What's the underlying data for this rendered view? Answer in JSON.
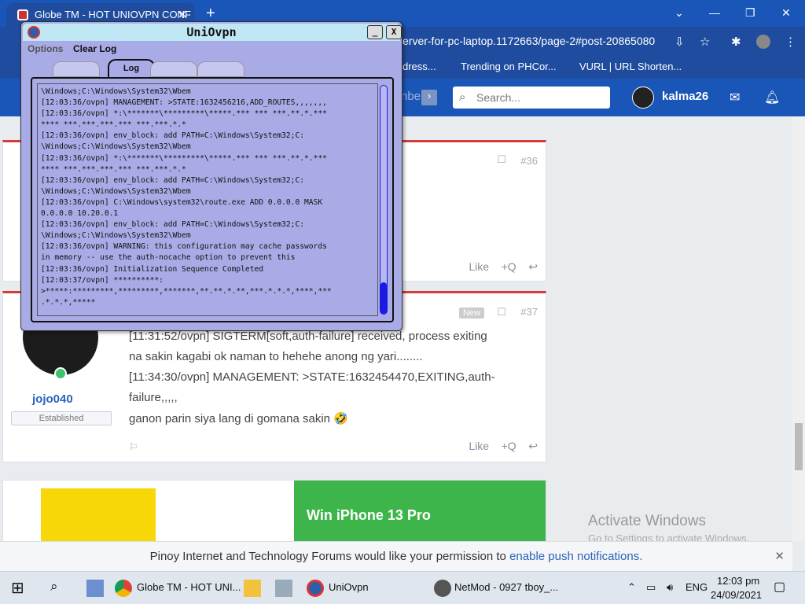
{
  "browser": {
    "tab_title": "Globe TM - HOT UNIOVPN CONF",
    "tab_close": "✕",
    "new_tab": "+",
    "url": "erver-for-pc-laptop.1172663/page-2#post-20865080",
    "bookmarks": [
      "dress...",
      "Trending on PHCor...",
      "VURL | URL Shorten..."
    ],
    "window_controls": [
      "⌄",
      "—",
      "❐",
      "✕"
    ]
  },
  "site": {
    "search_placeholder": "Search...",
    "username": "kalma26",
    "sidebar_label": "nbe"
  },
  "posts": [
    {
      "number": "#36",
      "reactions": [
        "Like",
        "+Q",
        "↩"
      ]
    },
    {
      "number": "#37",
      "badge": "New",
      "author": "jojo040",
      "rank": "Established",
      "lines": [
        "[11:31:52/ovpn] SIGTERM[soft,auth-failure] received, process exiting",
        "na sakin kagabi ok naman to hehehe anong ng yari........",
        "[11:34:30/ovpn] MANAGEMENT: >STATE:1632454470,EXITING,auth-",
        "failure,,,,,",
        "ganon parin siya lang di gomana sakin 🤣"
      ],
      "reactions": [
        "Like",
        "+Q",
        "↩"
      ]
    }
  ],
  "ads": {
    "headline": "Win iPhone 13 Pro"
  },
  "activate": {
    "title": "Activate Windows",
    "subtitle": "Go to Settings to activate Windows."
  },
  "notification": {
    "text": "Pinoy Internet and Technology Forums would like your permission to ",
    "link": "enable push notifications.",
    "close": "✕"
  },
  "uniovpn": {
    "title": "UniOvpn",
    "minimize": "_",
    "close": "X",
    "menu": [
      "Options",
      "Clear Log"
    ],
    "tabs": [
      "Log"
    ],
    "log": "\\Windows;C:\\Windows\\System32\\Wbem\n[12:03:36/ovpn] MANAGEMENT: >STATE:1632456216,ADD_ROUTES,,,,,,,\n[12:03:36/ovpn] *:\\*******\\*********\\*****.*** *** ***.**.*.***\n**** ***.***.***.*** ***.***.*.*\n[12:03:36/ovpn] env_block: add PATH=C:\\Windows\\System32;C:\n\\Windows;C:\\Windows\\System32\\Wbem\n[12:03:36/ovpn] *:\\*******\\*********\\*****.*** *** ***.**.*.***\n**** ***.***.***.*** ***.***.*.*\n[12:03:36/ovpn] env_block: add PATH=C:\\Windows\\System32;C:\n\\Windows;C:\\Windows\\System32\\Wbem\n[12:03:36/ovpn] C:\\Windows\\system32\\route.exe ADD 0.0.0.0 MASK\n0.0.0.0 10.20.0.1\n[12:03:36/ovpn] env_block: add PATH=C:\\Windows\\System32;C:\n\\Windows;C:\\Windows\\System32\\Wbem\n[12:03:36/ovpn] WARNING: this configuration may cache passwords\nin memory -- use the auth-nocache option to prevent this\n[12:03:36/ovpn] Initialization Sequence Completed\n[12:03:37/ovpn] **********:\n>*****:*********,*********,*******,**.**.*.**,***.*.*.*,****,***\n.*.*.*,*****"
  },
  "taskbar": {
    "items": [
      "Globe TM - HOT UNI...",
      "UniOvpn",
      "NetMod - 0927 tboy_..."
    ],
    "lang": "ENG",
    "time": "12:03 pm",
    "date": "24/09/2021"
  }
}
